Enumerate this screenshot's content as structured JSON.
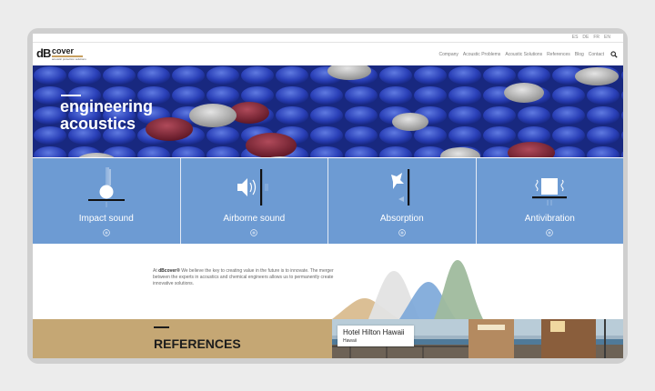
{
  "languages": [
    "ES",
    "DE",
    "FR",
    "EN"
  ],
  "logo": {
    "db": "dB",
    "cover": "cover",
    "tagline": "acoustic protection solutions"
  },
  "nav": [
    "Company",
    "Acoustic Problems",
    "Acoustic Solutions",
    "References",
    "Blog",
    "Contact"
  ],
  "hero": {
    "title_line1": "engineering",
    "title_line2": "acoustics"
  },
  "services": [
    {
      "label": "Impact sound",
      "icon": "impact-sound-icon"
    },
    {
      "label": "Airborne sound",
      "icon": "airborne-sound-icon"
    },
    {
      "label": "Absorption",
      "icon": "absorption-icon"
    },
    {
      "label": "Antivibration",
      "icon": "antivibration-icon"
    }
  ],
  "about": {
    "brand": "dBcover®",
    "text": " We believe the key to creating value in the future is to innovate. The merger between the experts in acoustics and chemical engineers allows us to permanently create innovative solutions."
  },
  "references": {
    "title": "REFERENCES",
    "hotel_name": "Hotel Hilton Hawaii",
    "hotel_place": "Hawaii"
  },
  "colors": {
    "service_blue": "#6d9bd3",
    "references_gold": "#c5a774",
    "hero_blue": "#2e43a8"
  }
}
